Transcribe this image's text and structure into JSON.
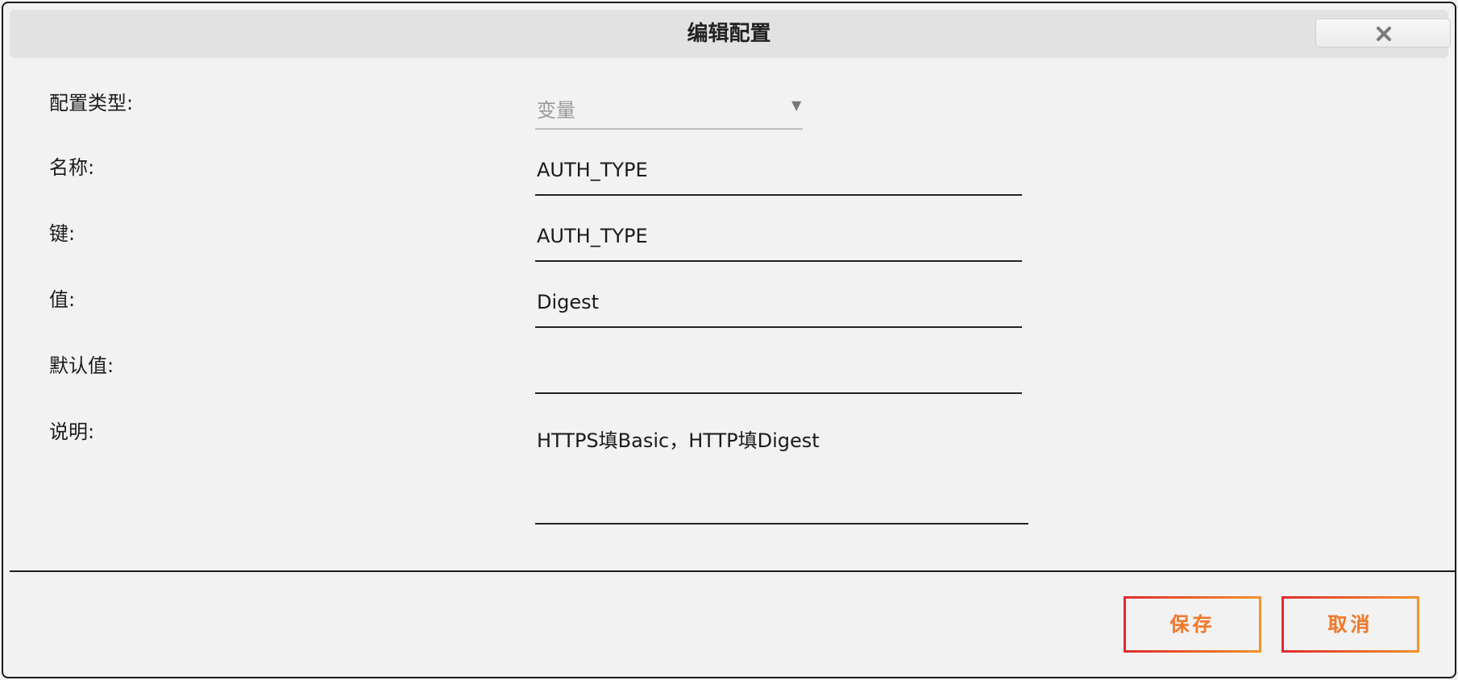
{
  "dialog": {
    "title": "编辑配置"
  },
  "form": {
    "config_type": {
      "label": "配置类型:",
      "value": "变量"
    },
    "name": {
      "label": "名称:",
      "value": "AUTH_TYPE"
    },
    "key": {
      "label": "键:",
      "value": "AUTH_TYPE"
    },
    "value": {
      "label": "值:",
      "value": "Digest"
    },
    "default_value": {
      "label": "默认值:",
      "value": ""
    },
    "description": {
      "label": "说明:",
      "value": "HTTPS填Basic，HTTP填Digest"
    }
  },
  "footer": {
    "save_label": "保存",
    "cancel_label": "取消"
  },
  "colors": {
    "accent_start": "#de2b2b",
    "accent_end": "#f4922c",
    "background": "#f2f2f2",
    "titlebar": "#e2e2e2"
  },
  "icons": {
    "close": "close-icon",
    "dropdown": "chevron-down-icon"
  }
}
